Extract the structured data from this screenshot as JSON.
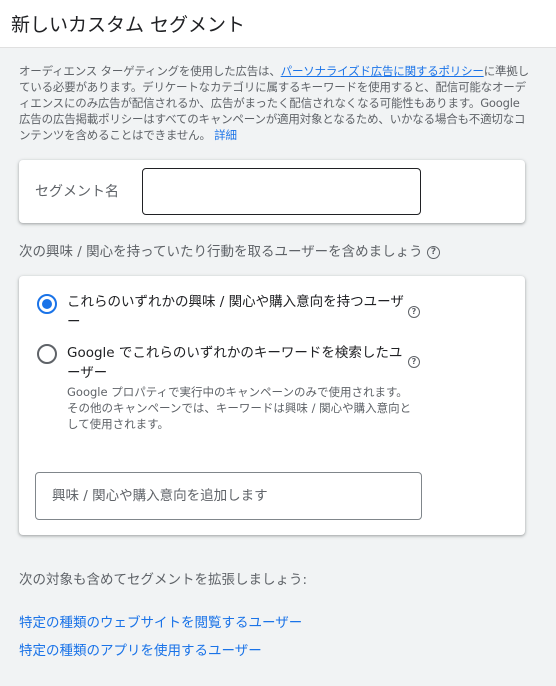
{
  "header": {
    "title": "新しいカスタム セグメント"
  },
  "policy": {
    "text_before": "オーディエンス ターゲティングを使用した広告は、",
    "policy_link": "パーソナライズド広告に関するポリシー",
    "text_after": "に準拠している必要があります。デリケートなカテゴリに属するキーワードを使用すると、配信可能なオーディエンスにのみ広告が配信されるか、広告がまったく配信されなくなる可能性もあります。Google 広告の広告掲載ポリシーはすべてのキャンペーンが適用対象となるため、いかなる場合も不適切なコンテンツを含めることはできません。",
    "details_link": "詳細"
  },
  "segment_name": {
    "label": "セグメント名",
    "value": ""
  },
  "include_section": {
    "text": "次の興味 / 関心を持っていたり行動を取るユーザーを含めましょう",
    "help_icon": "help-circle-icon"
  },
  "criteria": {
    "option1": {
      "label": "これらのいずれかの興味 / 関心や購入意向を持つユーザー",
      "checked": true
    },
    "option2": {
      "label": "Google でこれらのいずれかのキーワードを検索したユーザー",
      "description": "Google プロパティで実行中のキャンペーンのみで使用されます。その他のキャンペーンでは、キーワードは興味 / 関心や購入意向として使用されます。",
      "checked": false
    },
    "input_placeholder": "興味 / 関心や購入意向を追加します"
  },
  "expand": {
    "text": "次の対象も含めてセグメントを拡張しましょう:",
    "link_websites": "特定の種類のウェブサイトを閲覧するユーザー",
    "link_apps": "特定の種類のアプリを使用するユーザー"
  },
  "colors": {
    "accent": "#1a73e8",
    "text_primary": "#202124",
    "text_secondary": "#5f6368",
    "background": "#f1f3f4"
  }
}
